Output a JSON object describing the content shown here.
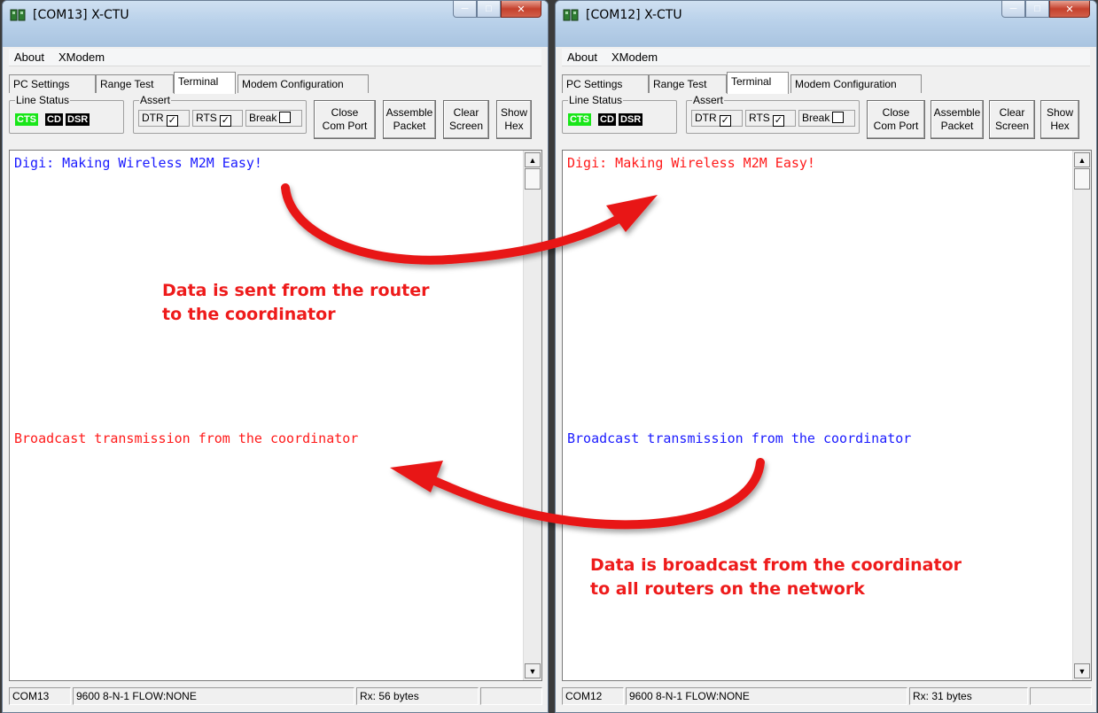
{
  "left": {
    "title": "[COM13] X-CTU",
    "menu": [
      "About",
      "XModem"
    ],
    "tabs": [
      "PC Settings",
      "Range Test",
      "Terminal",
      "Modem Configuration"
    ],
    "line_status_title": "Line Status",
    "leds": [
      "CTS",
      "CD",
      "DSR"
    ],
    "assert_title": "Assert",
    "assert": [
      "DTR",
      "RTS",
      "Break"
    ],
    "buttons": [
      [
        "Close",
        "Com Port"
      ],
      [
        "Assemble",
        "Packet"
      ],
      [
        "Clear",
        "Screen"
      ],
      [
        "Show",
        "Hex"
      ]
    ],
    "terminal_lines": [
      "Digi: Making Wireless M2M Easy!",
      "Broadcast transmission from the coordinator"
    ],
    "terminal_colors": [
      "#1a1aff",
      "#ff1a1a"
    ],
    "status": [
      "COM13",
      "9600 8-N-1  FLOW:NONE",
      "Rx: 56 bytes"
    ]
  },
  "right": {
    "title": "[COM12] X-CTU",
    "menu": [
      "About",
      "XModem"
    ],
    "tabs": [
      "PC Settings",
      "Range Test",
      "Terminal",
      "Modem Configuration"
    ],
    "line_status_title": "Line Status",
    "leds": [
      "CTS",
      "CD",
      "DSR"
    ],
    "assert_title": "Assert",
    "assert": [
      "DTR",
      "RTS",
      "Break"
    ],
    "buttons": [
      [
        "Close",
        "Com Port"
      ],
      [
        "Assemble",
        "Packet"
      ],
      [
        "Clear",
        "Screen"
      ],
      [
        "Show",
        "Hex"
      ]
    ],
    "terminal_lines": [
      "Digi: Making Wireless M2M Easy!",
      "Broadcast transmission from the coordinator"
    ],
    "terminal_colors": [
      "#ff1a1a",
      "#1a1aff"
    ],
    "status": [
      "COM12",
      "9600 8-N-1  FLOW:NONE",
      "Rx: 31 bytes"
    ]
  },
  "annotations": {
    "top": [
      "Data is sent from the router",
      "to the coordinator"
    ],
    "bottom": [
      "Data is broadcast from the coordinator",
      "to all routers on the network"
    ],
    "color": "#ee1b1b"
  },
  "icons": [
    "xctu-app-icon",
    "minimize-icon",
    "maximize-icon",
    "close-icon",
    "check-icon",
    "scroll-up-icon",
    "scroll-down-icon",
    "curved-arrow-icon"
  ]
}
